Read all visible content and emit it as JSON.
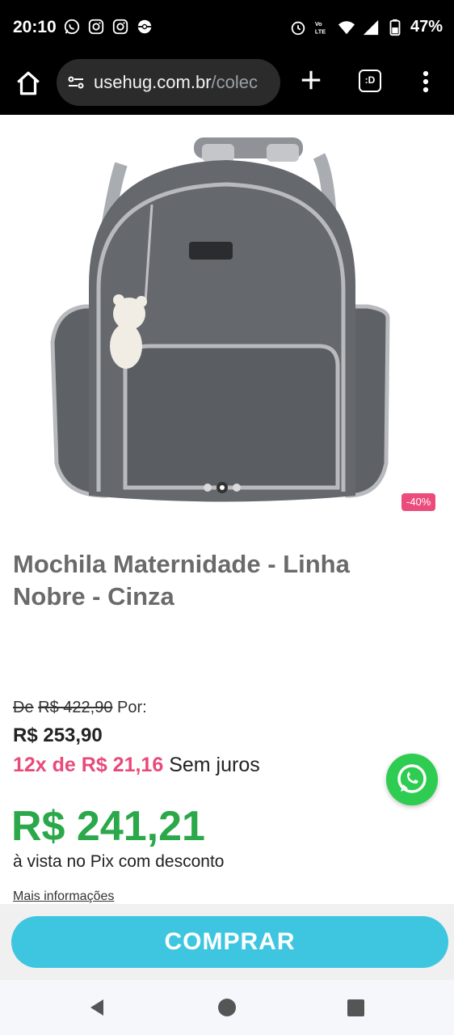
{
  "status_bar": {
    "time": "20:10",
    "battery": "47%",
    "icons": [
      "whatsapp-icon",
      "instagram-icon",
      "instagram-icon",
      "pokeball-icon",
      "alarm-icon",
      "volte-icon",
      "wifi-icon",
      "signal-icon",
      "battery-icon"
    ]
  },
  "browser": {
    "url_domain": "usehug.com.br",
    "url_path": "/colec",
    "tabs_label": ":D",
    "icons": [
      "home-icon",
      "site-settings-icon",
      "plus-icon",
      "tabs-icon",
      "more-vert-icon"
    ]
  },
  "product": {
    "discount_badge": "-40%",
    "title": "Mochila Maternidade - Linha Nobre - Cinza",
    "old_price_prefix": "De",
    "old_price": "R$ 422,90",
    "old_price_suffix": "Por:",
    "price": "R$ 253,90",
    "installments_highlight": "12x de R$ 21,16",
    "installments_suffix": "Sem juros",
    "pix_price": "R$ 241,21",
    "pix_note": "à vista no Pix com desconto",
    "more_info": "Mais informações",
    "image_dots": 3,
    "active_dot": 2
  },
  "actions": {
    "buy_label": "COMPRAR"
  },
  "colors": {
    "accent_cyan": "#3ec6e0",
    "pink": "#e84a7a",
    "green": "#2aa84a",
    "whatsapp": "#2ecc51"
  }
}
